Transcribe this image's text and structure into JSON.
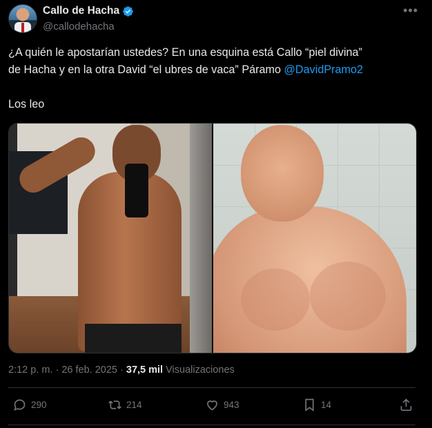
{
  "tweet": {
    "author_name": "Callo de Hacha",
    "author_handle": "@callodehacha",
    "text_line1": "¿A quién le apostarían ustedes? En una esquina está Callo “piel divina”",
    "text_line2_prefix": "de Hacha y en la otra David “el ubres de vaca” Páramo ",
    "mention": "@DavidPramo2",
    "text_line3": "Los leo",
    "timestamp": "2:12 p. m. · 26 feb. 2025 · ",
    "views_count": "37,5 mil",
    "views_label": " Visualizaciones"
  },
  "actions": {
    "replies": "290",
    "reposts": "214",
    "likes": "943",
    "bookmarks": "14"
  },
  "colors": {
    "background": "#000000",
    "accent": "#1d9bf0",
    "muted": "#71767b",
    "text": "#e7e9ea"
  },
  "icons": [
    "verified-badge-icon",
    "more-options-icon",
    "reply-icon",
    "repost-icon",
    "like-icon",
    "bookmark-icon",
    "share-icon"
  ]
}
